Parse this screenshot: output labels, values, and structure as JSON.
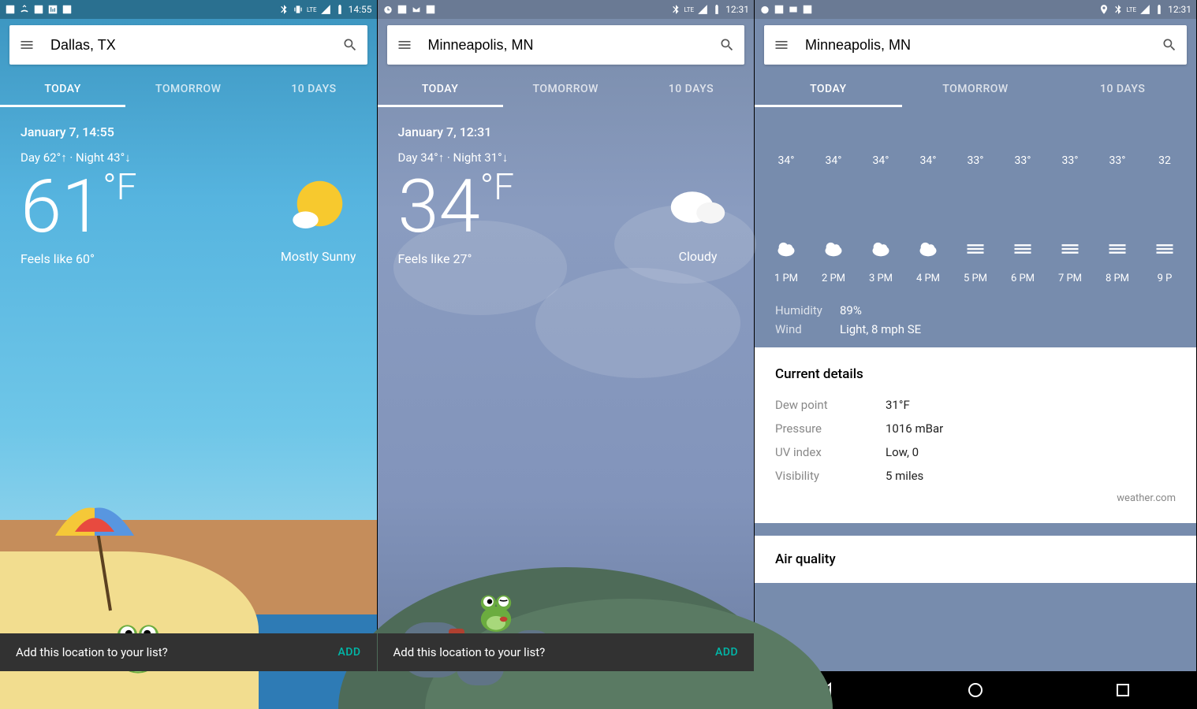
{
  "panels": [
    {
      "status_time": "14:55",
      "search_value": "Dallas, TX",
      "tabs": [
        "TODAY",
        "TOMORROW",
        "10 DAYS"
      ],
      "active_tab": 0,
      "date": "January 7, 14:55",
      "day_temp": "62°",
      "night_temp": "43°",
      "current_temp": "61",
      "temp_unit": "°F",
      "feels_like": "Feels like 60°",
      "condition": "Mostly Sunny",
      "snackbar_text": "Add this location to your list?",
      "snackbar_action": "ADD"
    },
    {
      "status_time": "12:31",
      "search_value": "Minneapolis, MN",
      "tabs": [
        "TODAY",
        "TOMORROW",
        "10 DAYS"
      ],
      "active_tab": 0,
      "date": "January 7, 12:31",
      "day_temp": "34°",
      "night_temp": "31°",
      "current_temp": "34",
      "temp_unit": "°F",
      "feels_like": "Feels like 27°",
      "condition": "Cloudy",
      "snackbar_text": "Add this location to your list?",
      "snackbar_action": "ADD"
    },
    {
      "status_time": "12:31",
      "search_value": "Minneapolis, MN",
      "tabs": [
        "TODAY",
        "TOMORROW",
        "10 DAYS"
      ],
      "active_tab": 0,
      "hourly": [
        {
          "temp": "34°",
          "icon": "cloud",
          "time": "1 PM"
        },
        {
          "temp": "34°",
          "icon": "cloud",
          "time": "2 PM"
        },
        {
          "temp": "34°",
          "icon": "cloud",
          "time": "3 PM"
        },
        {
          "temp": "34°",
          "icon": "cloud",
          "time": "4 PM"
        },
        {
          "temp": "33°",
          "icon": "fog",
          "time": "5 PM"
        },
        {
          "temp": "33°",
          "icon": "fog",
          "time": "6 PM"
        },
        {
          "temp": "33°",
          "icon": "fog",
          "time": "7 PM"
        },
        {
          "temp": "33°",
          "icon": "fog",
          "time": "8 PM"
        },
        {
          "temp": "32",
          "icon": "fog",
          "time": "9 P"
        }
      ],
      "humidity_label": "Humidity",
      "humidity_value": "89%",
      "wind_label": "Wind",
      "wind_value": "Light, 8 mph SE",
      "details_title": "Current details",
      "details": [
        {
          "label": "Dew point",
          "value": "31°F"
        },
        {
          "label": "Pressure",
          "value": "1016 mBar"
        },
        {
          "label": "UV index",
          "value": "Low, 0"
        },
        {
          "label": "Visibility",
          "value": "5 miles"
        }
      ],
      "attribution": "weather.com",
      "air_quality_title": "Air quality"
    }
  ]
}
